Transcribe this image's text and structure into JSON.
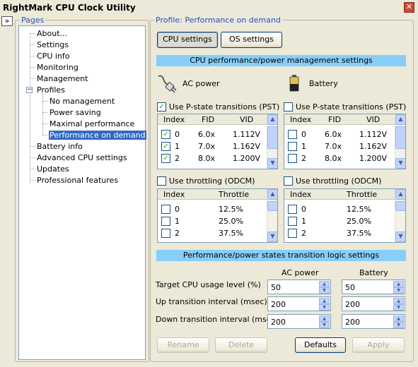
{
  "window": {
    "title": "RightMark CPU Clock Utility",
    "close_glyph": "✕",
    "collapse_glyph": "»"
  },
  "pages": {
    "group_label": "Pages",
    "items": [
      "About...",
      "Settings",
      "CPU info",
      "Monitoring",
      "Management",
      "Profiles",
      "No management",
      "Power saving",
      "Maximal performance",
      "Performance on demand",
      "Battery info",
      "Advanced CPU settings",
      "Updates",
      "Professional features"
    ],
    "expander_glyph": "−"
  },
  "profile": {
    "group_label": "Profile: Performance on demand",
    "tabs": [
      "CPU settings",
      "OS settings"
    ],
    "cpu_section": "CPU performance/power management settings",
    "ac_label": "AC power",
    "battery_label": "Battery",
    "pst_label": "Use P-state transitions (PST)",
    "pst_headers": [
      "Index",
      "FID",
      "VID"
    ],
    "pst_rows": [
      {
        "index": "0",
        "fid": "6.0x",
        "vid": "1.112V"
      },
      {
        "index": "1",
        "fid": "7.0x",
        "vid": "1.162V"
      },
      {
        "index": "2",
        "fid": "8.0x",
        "vid": "1.200V"
      }
    ],
    "odcm_label": "Use throttling (ODCM)",
    "odcm_headers": [
      "Index",
      "Throttle"
    ],
    "odcm_rows": [
      {
        "index": "0",
        "throttle": "12.5%"
      },
      {
        "index": "1",
        "throttle": "25.0%"
      },
      {
        "index": "2",
        "throttle": "37.5%"
      }
    ],
    "transition_section": "Performance/power states transition logic settings",
    "col_ac": "AC power",
    "col_battery": "Battery",
    "settings": [
      {
        "label": "Target CPU usage level (%)",
        "ac": "50",
        "battery": "50"
      },
      {
        "label": "Up transition interval (msec)",
        "ac": "200",
        "battery": "200"
      },
      {
        "label": "Down transition interval (msec)",
        "ac": "200",
        "battery": "200"
      }
    ],
    "buttons": {
      "rename": "Rename",
      "delete": "Delete",
      "defaults": "Defaults",
      "apply": "Apply"
    },
    "checkmark": "✓",
    "arrow_up": "▲",
    "arrow_down": "▼"
  },
  "colors": {
    "section_bar": "#87cefa",
    "selection": "#316ac5",
    "group_label": "#2453b8"
  }
}
